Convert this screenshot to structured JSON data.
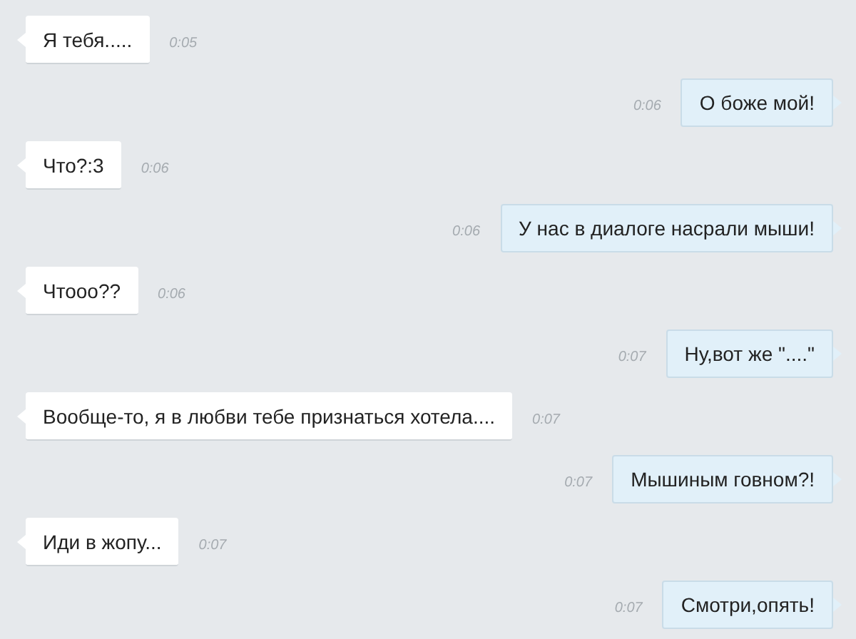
{
  "messages": [
    {
      "kind": "incoming",
      "text": "Я тебя.....",
      "time": "0:05"
    },
    {
      "kind": "outgoing",
      "text": "О боже мой!",
      "time": "0:06"
    },
    {
      "kind": "incoming",
      "text": "Что?:3",
      "time": "0:06"
    },
    {
      "kind": "outgoing",
      "text": "У нас в диалоге насрали мыши!",
      "time": "0:06"
    },
    {
      "kind": "incoming",
      "text": "Чтооо??",
      "time": "0:06"
    },
    {
      "kind": "outgoing",
      "text": "Ну,вот же \"....\"",
      "time": "0:07"
    },
    {
      "kind": "incoming",
      "text": "Вообще-то, я в любви тебе признаться хотела....",
      "time": "0:07"
    },
    {
      "kind": "outgoing",
      "text": "Мышиным говном?!",
      "time": "0:07"
    },
    {
      "kind": "incoming",
      "text": "Иди в жопу...",
      "time": "0:07"
    },
    {
      "kind": "outgoing",
      "text": "Смотри,опять!",
      "time": "0:07"
    }
  ]
}
